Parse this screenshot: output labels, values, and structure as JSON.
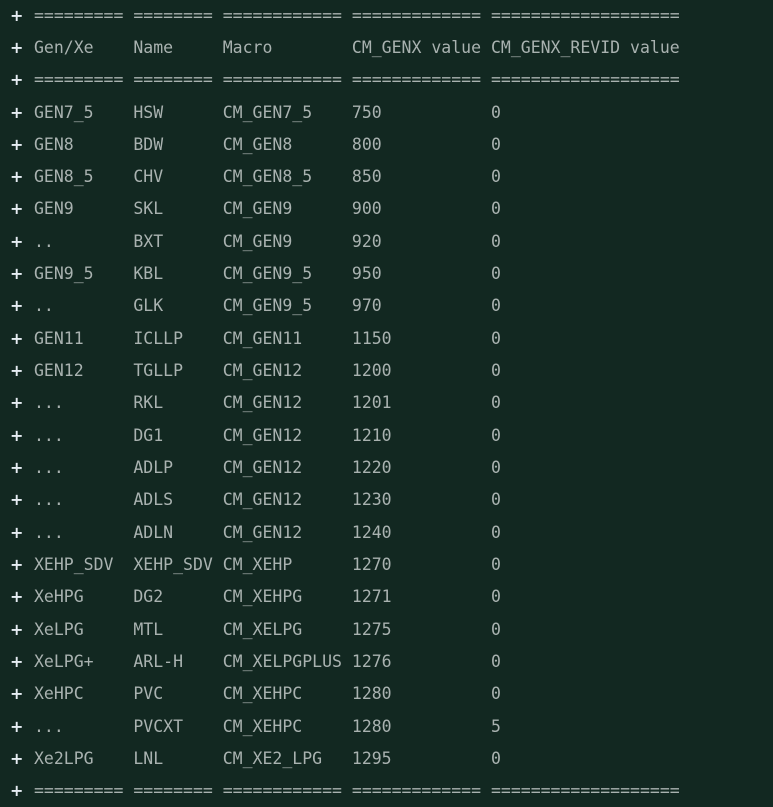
{
  "marker": "+",
  "lines": [
    "========= ======== ============ ============= ===================",
    "Gen/Xe    Name     Macro        CM_GENX value CM_GENX_REVID value",
    "========= ======== ============ ============= ===================",
    "GEN7_5    HSW      CM_GEN7_5    750           0",
    "GEN8      BDW      CM_GEN8      800           0",
    "GEN8_5    CHV      CM_GEN8_5    850           0",
    "GEN9      SKL      CM_GEN9      900           0",
    "..        BXT      CM_GEN9      920           0",
    "GEN9_5    KBL      CM_GEN9_5    950           0",
    "..        GLK      CM_GEN9_5    970           0",
    "GEN11     ICLLP    CM_GEN11     1150          0",
    "GEN12     TGLLP    CM_GEN12     1200          0",
    "...       RKL      CM_GEN12     1201          0",
    "...       DG1      CM_GEN12     1210          0",
    "...       ADLP     CM_GEN12     1220          0",
    "...       ADLS     CM_GEN12     1230          0",
    "...       ADLN     CM_GEN12     1240          0",
    "XEHP_SDV  XEHP_SDV CM_XEHP      1270          0",
    "XeHPG     DG2      CM_XEHPG     1271          0",
    "XeLPG     MTL      CM_XELPG     1275          0",
    "XeLPG+    ARL-H    CM_XELPGPLUS 1276          0",
    "XeHPC     PVC      CM_XEHPC     1280          0",
    "...       PVCXT    CM_XEHPC     1280          5",
    "Xe2LPG    LNL      CM_XE2_LPG   1295          0",
    "========= ======== ============ ============= ==================="
  ]
}
